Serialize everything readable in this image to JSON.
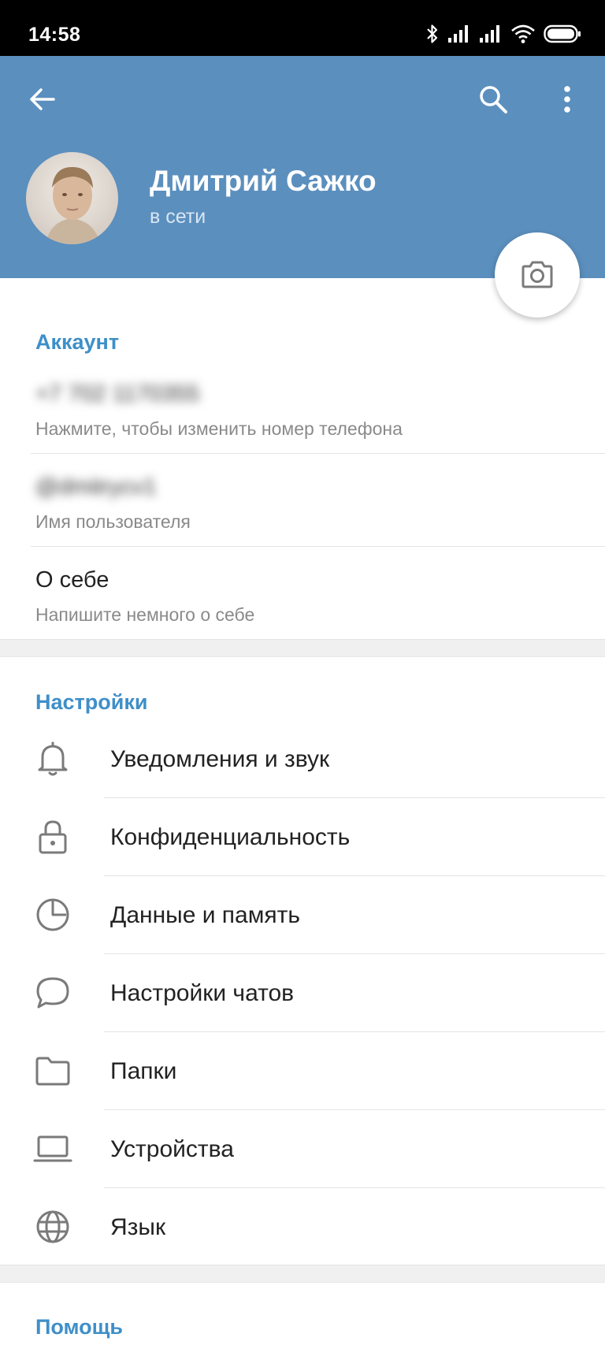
{
  "status_bar": {
    "time": "14:58",
    "icons": [
      "bluetooth-icon",
      "signal-icon",
      "signal-icon",
      "wifi-icon",
      "battery-icon"
    ]
  },
  "toolbar": {
    "back_icon": "arrow-left-icon",
    "search_icon": "search-icon",
    "menu_icon": "more-vertical-icon"
  },
  "profile": {
    "name": "Дмитрий Сажко",
    "status": "в сети",
    "camera_icon": "camera-icon"
  },
  "account": {
    "title": "Аккаунт",
    "phone": "+7 702 1170355",
    "phone_hint": "Нажмите, чтобы изменить номер телефона",
    "username": "@dmitrycv1",
    "username_hint": "Имя пользователя",
    "bio": "О себе",
    "bio_hint": "Напишите немного о себе"
  },
  "settings": {
    "title": "Настройки",
    "items": [
      {
        "label": "Уведомления и звук",
        "icon": "bell-icon"
      },
      {
        "label": "Конфиденциальность",
        "icon": "lock-icon"
      },
      {
        "label": "Данные и память",
        "icon": "pie-chart-icon"
      },
      {
        "label": "Настройки чатов",
        "icon": "chat-bubble-icon"
      },
      {
        "label": "Папки",
        "icon": "folder-icon"
      },
      {
        "label": "Устройства",
        "icon": "laptop-icon"
      },
      {
        "label": "Язык",
        "icon": "globe-icon"
      }
    ]
  },
  "help": {
    "title": "Помощь"
  },
  "colors": {
    "header_bg": "#5b8fbe",
    "accent": "#3e8fc9",
    "icon_gray": "#7a7a7a"
  }
}
